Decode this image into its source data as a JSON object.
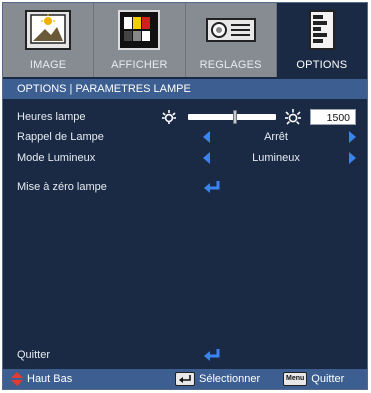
{
  "tabs": [
    {
      "label": "IMAGE",
      "icon": "image-icon",
      "active": false
    },
    {
      "label": "AFFICHER",
      "icon": "display-icon",
      "active": false
    },
    {
      "label": "REGLAGES",
      "icon": "projector-icon",
      "active": false
    },
    {
      "label": "OPTIONS",
      "icon": "options-icon",
      "active": true
    }
  ],
  "header": {
    "title": "OPTIONS | PARAMETRES LAMPE"
  },
  "rows": {
    "lamp_hours": {
      "label": "Heures lampe",
      "value": "1500"
    },
    "lamp_reminder": {
      "label": "Rappel de Lampe",
      "value": "Arrêt"
    },
    "bright_mode": {
      "label": "Mode Lumineux",
      "value": "Lumineux"
    },
    "lamp_reset": {
      "label": "Mise à zéro lampe"
    },
    "exit": {
      "label": "Quitter"
    }
  },
  "footer": {
    "nav_label": "Haut Bas",
    "select_label": "Sélectionner",
    "menu_key": "Menu",
    "quit_label": "Quitter"
  },
  "colors": {
    "background": "#1b2a44",
    "header": "#3c5e91",
    "tab_inactive": "#878b92",
    "arrow_blue": "#3b83f0",
    "nav_red": "#e23b2f"
  }
}
